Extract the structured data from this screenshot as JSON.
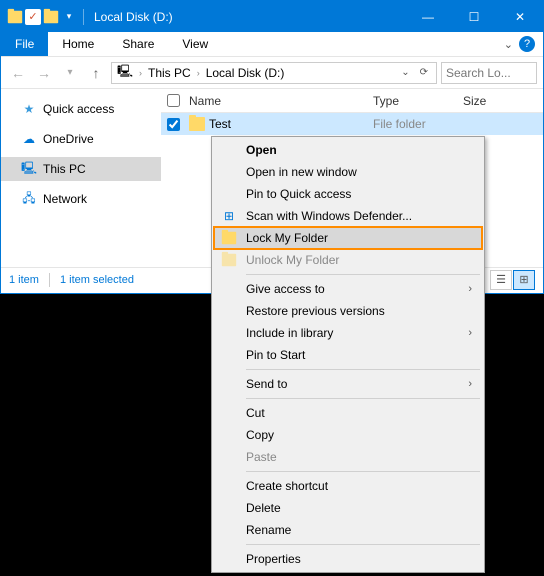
{
  "titlebar": {
    "title": "Local Disk (D:)",
    "minimize": "—",
    "maximize": "☐",
    "close": "✕"
  },
  "ribbon": {
    "file": "File",
    "home": "Home",
    "share": "Share",
    "view": "View"
  },
  "breadcrumb": {
    "thispc": "This PC",
    "drive": "Local Disk (D:)"
  },
  "search": {
    "placeholder": "Search Lo..."
  },
  "sidebar": {
    "quickaccess": "Quick access",
    "onedrive": "OneDrive",
    "thispc": "This PC",
    "network": "Network"
  },
  "columns": {
    "name": "Name",
    "type": "Type",
    "size": "Size"
  },
  "row": {
    "name": "Test",
    "type": "File folder"
  },
  "status": {
    "count": "1 item",
    "selected": "1 item selected"
  },
  "ctx": {
    "open": "Open",
    "openNew": "Open in new window",
    "pinQuick": "Pin to Quick access",
    "scan": "Scan with Windows Defender...",
    "lock": "Lock My Folder",
    "unlock": "Unlock My Folder",
    "giveAccess": "Give access to",
    "restore": "Restore previous versions",
    "includeLib": "Include in library",
    "pinStart": "Pin to Start",
    "sendTo": "Send to",
    "cut": "Cut",
    "copy": "Copy",
    "paste": "Paste",
    "shortcut": "Create shortcut",
    "delete": "Delete",
    "rename": "Rename",
    "properties": "Properties"
  }
}
